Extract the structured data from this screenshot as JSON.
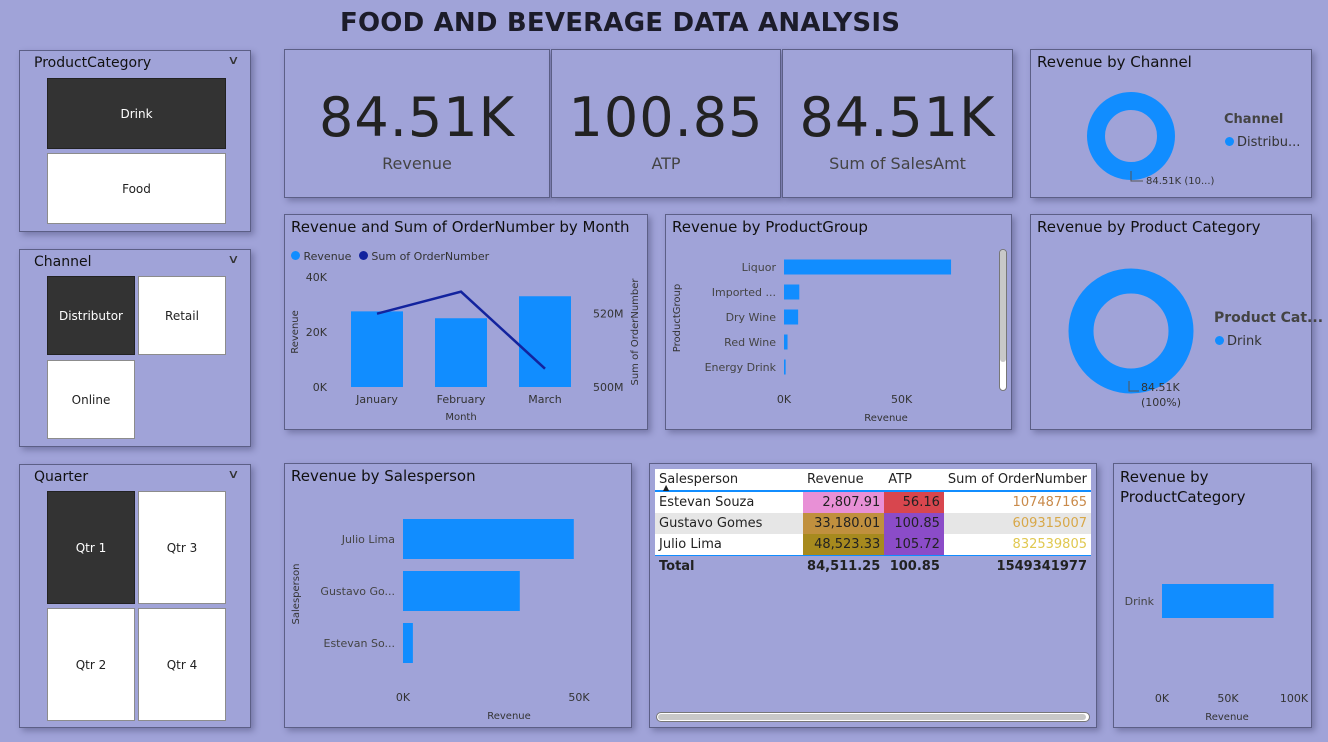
{
  "page_title": "FOOD AND BEVERAGE DATA ANALYSIS",
  "colors": {
    "bar": "#118DFF",
    "line": "#12239E",
    "background": "#A0A3D8",
    "selected_tile": "#333333"
  },
  "slicers": {
    "product_category": {
      "title": "ProductCategory",
      "items": [
        "Drink",
        "Food"
      ],
      "selected": "Drink"
    },
    "channel": {
      "title": "Channel",
      "items": [
        "Distributor",
        "Retail",
        "Online"
      ],
      "selected": "Distributor"
    },
    "quarter": {
      "title": "Quarter",
      "items": [
        "Qtr 1",
        "Qtr 3",
        "Qtr 2",
        "Qtr 4"
      ],
      "selected": "Qtr 1"
    }
  },
  "kpis": [
    {
      "value": "84.51K",
      "label": "Revenue"
    },
    {
      "value": "100.85",
      "label": "ATP"
    },
    {
      "value": "84.51K",
      "label": "Sum of SalesAmt"
    }
  ],
  "revenue_by_channel": {
    "title": "Revenue by Channel",
    "legend_title": "Channel",
    "legend_item": "Distribu...",
    "data_label": "84.51K (10...)"
  },
  "revenue_by_product_category_donut": {
    "title": "Revenue by Product Category",
    "legend_title": "Product Cat...",
    "legend_item": "Drink",
    "data_label_1": "84.51K",
    "data_label_2": "(100%)"
  },
  "chart_data": [
    {
      "type": "bar",
      "title": "Revenue and Sum of OrderNumber by Month",
      "categories": [
        "January",
        "February",
        "March"
      ],
      "series": [
        {
          "name": "Revenue",
          "values": [
            27500,
            25000,
            33000
          ]
        },
        {
          "name": "Sum of OrderNumber",
          "values": [
            520000000,
            526000000,
            505000000
          ]
        }
      ],
      "xlabel": "Month",
      "ylabel": "Revenue",
      "y2label": "Sum of OrderNumber",
      "y_ticks": [
        "0K",
        "20K",
        "40K"
      ],
      "y2_ticks": [
        "500M",
        "520M"
      ],
      "ylim": [
        0,
        40000
      ],
      "y2lim": [
        500000000,
        530000000
      ],
      "legend": "top-left"
    },
    {
      "type": "bar",
      "title": "Revenue by ProductGroup",
      "orientation": "horizontal",
      "categories": [
        "Liquor",
        "Imported ...",
        "Dry Wine",
        "Red Wine",
        "Energy Drink"
      ],
      "values": [
        71000,
        6500,
        6000,
        1500,
        700
      ],
      "xlabel": "Revenue",
      "ylabel": "ProductGroup",
      "x_ticks": [
        "0K",
        "50K"
      ],
      "xlim": [
        0,
        85000
      ]
    },
    {
      "type": "bar",
      "title": "Revenue by Salesperson",
      "orientation": "horizontal",
      "categories": [
        "Julio Lima",
        "Gustavo Go...",
        "Estevan So..."
      ],
      "values": [
        48523.33,
        33180.01,
        2807.91
      ],
      "xlabel": "Revenue",
      "ylabel": "Salesperson",
      "x_ticks": [
        "0K",
        "50K"
      ],
      "xlim": [
        0,
        50000
      ]
    },
    {
      "type": "bar",
      "title": "Revenue by ProductCategory",
      "orientation": "horizontal",
      "categories": [
        "Drink"
      ],
      "values": [
        84511.25
      ],
      "xlabel": "Revenue",
      "x_ticks": [
        "0K",
        "50K",
        "100K"
      ],
      "xlim": [
        0,
        100000
      ]
    }
  ],
  "table": {
    "headers": [
      "Salesperson",
      "Revenue",
      "ATP",
      "Sum of OrderNumber"
    ],
    "rows": [
      {
        "name": "Estevan Souza",
        "revenue": "2,807.91",
        "atp": "56.16",
        "orders": "107487165"
      },
      {
        "name": "Gustavo Gomes",
        "revenue": "33,180.01",
        "atp": "100.85",
        "orders": "609315007"
      },
      {
        "name": "Julio Lima",
        "revenue": "48,523.33",
        "atp": "105.72",
        "orders": "832539805"
      }
    ],
    "total": {
      "name": "Total",
      "revenue": "84,511.25",
      "atp": "100.85",
      "orders": "1549341977"
    },
    "revenue_colors": [
      "#E890D6",
      "#C0903E",
      "#A78A1E"
    ],
    "atp_colors": [
      "#D8464E",
      "#8B4CC8",
      "#8B4CC8"
    ],
    "orders_colors": [
      "#C98A4A",
      "#D8A848",
      "#E0C850"
    ]
  }
}
